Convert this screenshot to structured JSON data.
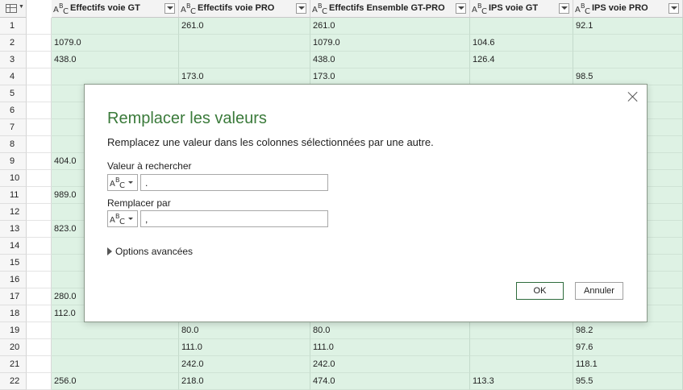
{
  "table": {
    "columns": [
      {
        "title": "Effectifs voie GT",
        "type_icon": "abc-type-icon"
      },
      {
        "title": "Effectifs voie PRO",
        "type_icon": "abc-type-icon"
      },
      {
        "title": "Effectifs Ensemble GT-PRO",
        "type_icon": "abc-type-icon"
      },
      {
        "title": "IPS voie GT",
        "type_icon": "abc-type-icon"
      },
      {
        "title": "IPS voie PRO",
        "type_icon": "abc-type-icon"
      }
    ],
    "rows": [
      {
        "n": "1",
        "c": [
          "",
          "261.0",
          "261.0",
          "",
          "92.1"
        ]
      },
      {
        "n": "2",
        "c": [
          "1079.0",
          "",
          "1079.0",
          "104.6",
          ""
        ]
      },
      {
        "n": "3",
        "c": [
          "438.0",
          "",
          "438.0",
          "126.4",
          ""
        ]
      },
      {
        "n": "4",
        "c": [
          "",
          "173.0",
          "173.0",
          "",
          "98.5"
        ]
      },
      {
        "n": "5",
        "c": [
          "",
          "",
          "",
          "",
          ""
        ]
      },
      {
        "n": "6",
        "c": [
          "",
          "",
          "",
          "",
          ""
        ]
      },
      {
        "n": "7",
        "c": [
          "",
          "",
          "",
          "",
          ""
        ]
      },
      {
        "n": "8",
        "c": [
          "",
          "",
          "",
          "",
          ""
        ]
      },
      {
        "n": "9",
        "c": [
          "404.0",
          "",
          "",
          "",
          ""
        ]
      },
      {
        "n": "10",
        "c": [
          "",
          "",
          "",
          "",
          ""
        ]
      },
      {
        "n": "11",
        "c": [
          "989.0",
          "",
          "",
          "",
          ""
        ]
      },
      {
        "n": "12",
        "c": [
          "",
          "",
          "",
          "",
          ""
        ]
      },
      {
        "n": "13",
        "c": [
          "823.0",
          "",
          "",
          "",
          ""
        ]
      },
      {
        "n": "14",
        "c": [
          "",
          "",
          "",
          "",
          ""
        ]
      },
      {
        "n": "15",
        "c": [
          "",
          "",
          "",
          "",
          ""
        ]
      },
      {
        "n": "16",
        "c": [
          "",
          "",
          "",
          "",
          ""
        ]
      },
      {
        "n": "17",
        "c": [
          "280.0",
          "",
          "",
          "",
          ""
        ]
      },
      {
        "n": "18",
        "c": [
          "112.0",
          "",
          "",
          "",
          ""
        ]
      },
      {
        "n": "19",
        "c": [
          "",
          "80.0",
          "80.0",
          "",
          "98.2"
        ]
      },
      {
        "n": "20",
        "c": [
          "",
          "111.0",
          "111.0",
          "",
          "97.6"
        ]
      },
      {
        "n": "21",
        "c": [
          "",
          "242.0",
          "242.0",
          "",
          "118.1"
        ]
      },
      {
        "n": "22",
        "c": [
          "256.0",
          "218.0",
          "474.0",
          "113.3",
          "95.5"
        ]
      }
    ]
  },
  "dialog": {
    "title": "Remplacer les valeurs",
    "description": "Remplacez une valeur dans les colonnes sélectionnées par une autre.",
    "find_label": "Valeur à rechercher",
    "find_value": ".",
    "replace_label": "Remplacer par",
    "replace_value": ",",
    "advanced_label": "Options avancées",
    "ok_label": "OK",
    "cancel_label": "Annuler",
    "title_color": "#3a7a3a"
  }
}
